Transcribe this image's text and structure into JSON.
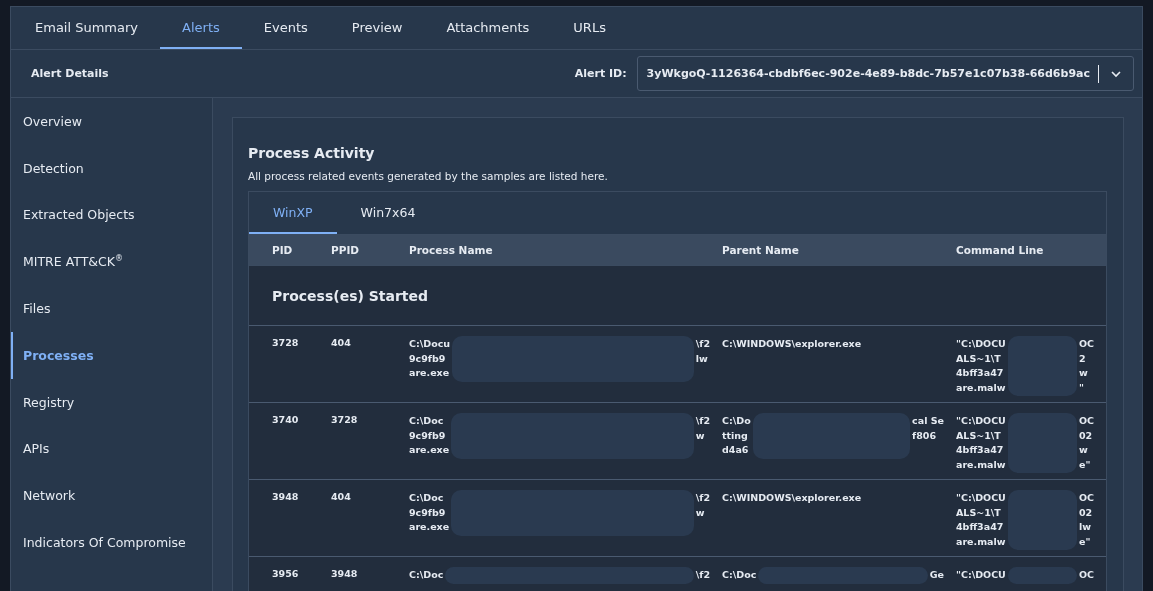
{
  "top_tabs": [
    {
      "label": "Email Summary",
      "selected": false
    },
    {
      "label": "Alerts",
      "selected": true
    },
    {
      "label": "Events",
      "selected": false
    },
    {
      "label": "Preview",
      "selected": false
    },
    {
      "label": "Attachments",
      "selected": false
    },
    {
      "label": "URLs",
      "selected": false
    }
  ],
  "header": {
    "title": "Alert Details",
    "alert_id_label": "Alert ID:",
    "alert_id": "3yWkgoQ-1126364-cbdbf6ec-902e-4e89-b8dc-7b57e1c07b38-66d6b9ac"
  },
  "sidebar": {
    "items": [
      {
        "label": "Overview",
        "selected": false
      },
      {
        "label": "Detection",
        "selected": false
      },
      {
        "label": "Extracted Objects",
        "selected": false
      },
      {
        "label": "MITRE ATT&CK$^{®}$",
        "selected": false
      },
      {
        "label": "Files",
        "selected": false
      },
      {
        "label": "Processes",
        "selected": true
      },
      {
        "label": "Registry",
        "selected": false
      },
      {
        "label": "APIs",
        "selected": false
      },
      {
        "label": "Network",
        "selected": false
      },
      {
        "label": "Indicators Of Compromise",
        "selected": false
      }
    ]
  },
  "panel": {
    "title": "Process Activity",
    "description": "All process related events generated by the samples are listed here.",
    "os_tabs": [
      {
        "label": "WinXP",
        "selected": true
      },
      {
        "label": "Win7x64",
        "selected": false
      }
    ],
    "table": {
      "columns": [
        "PID",
        "PPID",
        "Process Name",
        "Parent Name",
        "Command Line"
      ],
      "section": "Process(es) Started",
      "rows": [
        {
          "pid": "3728",
          "ppid": "404",
          "process_name": {
            "redacted": true,
            "lines": [
              [
                "C:\\Docu",
                "\\f2"
              ],
              [
                "9c9fb9",
                "lw"
              ],
              [
                "are.exe"
              ]
            ]
          },
          "parent_name": {
            "redacted": false,
            "lines": [
              [
                "C:\\WINDOWS\\explorer.exe"
              ]
            ]
          },
          "command_line": {
            "redacted": true,
            "lines": [
              [
                "\"C:\\DOCU",
                "OC"
              ],
              [
                "ALS~1\\T",
                "2"
              ],
              [
                "4bff3a47",
                "w"
              ],
              [
                "are.malw",
                "\""
              ]
            ]
          }
        },
        {
          "pid": "3740",
          "ppid": "3728",
          "process_name": {
            "redacted": true,
            "lines": [
              [
                "C:\\Doc",
                "\\f2"
              ],
              [
                "9c9fb9",
                "w"
              ],
              [
                "are.exe"
              ]
            ]
          },
          "parent_name": {
            "redacted": true,
            "lines": [
              [
                "C:\\Do",
                "cal Se"
              ],
              [
                "tting",
                "f806"
              ],
              [
                "d4a6"
              ]
            ]
          },
          "command_line": {
            "redacted": true,
            "lines": [
              [
                "\"C:\\DOCU",
                "OC"
              ],
              [
                "ALS~1\\T",
                "02"
              ],
              [
                "4bff3a47",
                "w"
              ],
              [
                "are.malw",
                "e\""
              ]
            ]
          }
        },
        {
          "pid": "3948",
          "ppid": "404",
          "process_name": {
            "redacted": true,
            "lines": [
              [
                "C:\\Doc",
                "\\f2"
              ],
              [
                "9c9fb9",
                "w"
              ],
              [
                "are.exe"
              ]
            ]
          },
          "parent_name": {
            "redacted": false,
            "lines": [
              [
                "C:\\WINDOWS\\explorer.exe"
              ]
            ]
          },
          "command_line": {
            "redacted": true,
            "lines": [
              [
                "\"C:\\DOCU",
                "OC"
              ],
              [
                "ALS~1\\T",
                "02"
              ],
              [
                "4bff3a47",
                "lw"
              ],
              [
                "are.malw",
                "e\""
              ]
            ]
          }
        },
        {
          "pid": "3956",
          "ppid": "3948",
          "process_name": {
            "redacted": true,
            "lines": [
              [
                "C:\\Doc",
                "\\f2"
              ]
            ]
          },
          "parent_name": {
            "redacted": true,
            "lines": [
              [
                "C:\\Doc",
                "Ge"
              ]
            ]
          },
          "command_line": {
            "redacted": true,
            "lines": [
              [
                "\"C:\\DOCU",
                "OC"
              ]
            ]
          }
        }
      ]
    }
  }
}
